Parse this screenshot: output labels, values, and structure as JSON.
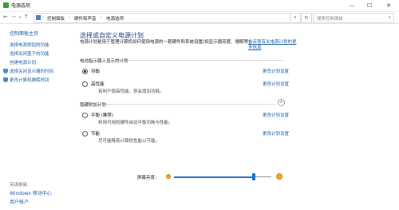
{
  "window": {
    "title": "电源选项",
    "controls": {
      "minimize": "—",
      "maximize": "☐",
      "close": "✕"
    }
  },
  "addressbar": {
    "nav": {
      "back": "←",
      "forward": "→",
      "recent": "∨",
      "up": "↑"
    },
    "crumbs": [
      "控制面板",
      "硬件和声音",
      "电源选项"
    ],
    "separator": "›",
    "dropdown": "∨",
    "refresh": "↻",
    "search_placeholder": "搜索控制面板",
    "search_icon": "⌕"
  },
  "sidebar": {
    "home": "控制面板主页",
    "links": [
      "选择电源按钮的功能",
      "选择关闭盖子的功能",
      "创建电源计划",
      "选择关闭显示器的时间",
      "更改计算机睡眠时间"
    ],
    "see_also": "另请参阅",
    "bottom_links": [
      "Windows 移动中心",
      "用户帐户"
    ]
  },
  "main": {
    "title": "选择或自定义电源计划",
    "description": "电源计划是用于管理计算机如何使用电源的一套硬件和系统设置(如显示器亮度、睡眠等)。",
    "description_link": "告诉我有关电源计划的更多信息",
    "section_shown": "电池指示器上显示的计划",
    "section_hidden": "隐藏附加计划",
    "collapse_icon": "∧",
    "plans_shown": [
      {
        "name": "均衡",
        "desc": "",
        "link": "更改计划设置",
        "checked": true
      },
      {
        "name": "高性能",
        "desc": "有利于提高性能，但会增加功耗。",
        "link": "更改计划设置",
        "checked": false
      }
    ],
    "plans_hidden": [
      {
        "name": "平衡 (推荐)",
        "desc": "利用可用的硬件自动平衡功耗与性能。",
        "link": "更改计划设置",
        "checked": false
      },
      {
        "name": "节能",
        "desc": "尽可能降低计算机性能以节能。",
        "link": "更改计划设置",
        "checked": false
      }
    ]
  },
  "brightness": {
    "label": "屏幕亮度:",
    "level_fraction": 0.82,
    "accent": "#1a6fd1"
  }
}
